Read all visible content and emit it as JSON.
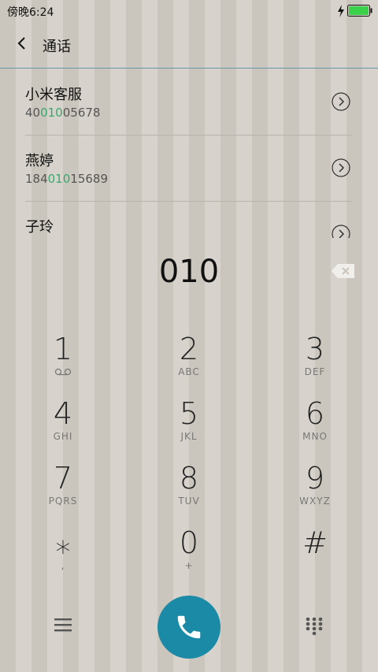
{
  "status_bar": {
    "time": "傍晚6:24",
    "battery_color": "#3bd14a"
  },
  "header": {
    "title": "通话"
  },
  "contacts": [
    {
      "name": "小米客服",
      "number_prefix": "40",
      "number_match": "010",
      "number_suffix": "05678"
    },
    {
      "name": "燕婷",
      "number_prefix": "184",
      "number_match": "010",
      "number_suffix": "15689"
    },
    {
      "name": "子玲",
      "number_prefix": "",
      "number_match": "",
      "number_suffix": ""
    }
  ],
  "dialer": {
    "display": "010",
    "accent_color": "#1a8aa7",
    "match_color": "#3aa86f"
  },
  "keypad": [
    {
      "digit": "1",
      "letters": ""
    },
    {
      "digit": "2",
      "letters": "ABC"
    },
    {
      "digit": "3",
      "letters": "DEF"
    },
    {
      "digit": "4",
      "letters": "GHI"
    },
    {
      "digit": "5",
      "letters": "JKL"
    },
    {
      "digit": "6",
      "letters": "MNO"
    },
    {
      "digit": "7",
      "letters": "PQRS"
    },
    {
      "digit": "8",
      "letters": "TUV"
    },
    {
      "digit": "9",
      "letters": "WXYZ"
    },
    {
      "digit": "⁎",
      "letters": ","
    },
    {
      "digit": "0",
      "letters": "+"
    },
    {
      "digit": "#",
      "letters": ""
    }
  ],
  "icons": {
    "back": "back-chevron-icon",
    "delete": "backspace-icon",
    "voicemail": "voicemail-icon",
    "menu": "hamburger-menu-icon",
    "call": "phone-icon",
    "keypad": "dialpad-icon"
  }
}
